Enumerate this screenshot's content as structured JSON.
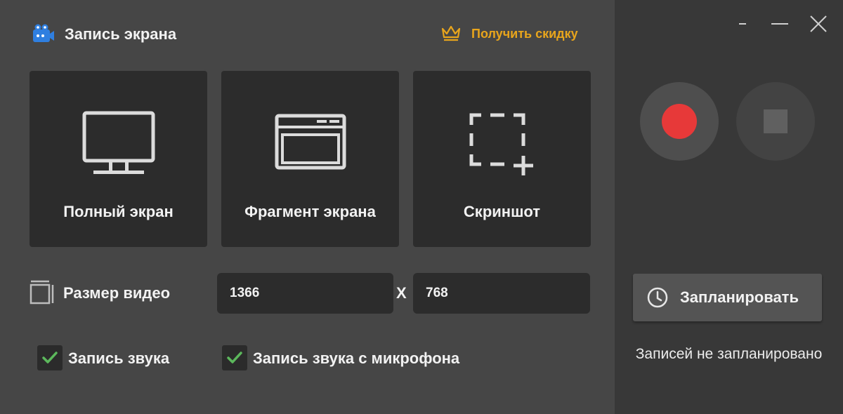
{
  "app": {
    "title": "Запись экрана",
    "discount_link": "Получить скидку"
  },
  "modes": [
    {
      "label": "Полный экран",
      "icon": "monitor-icon"
    },
    {
      "label": "Фрагмент экрана",
      "icon": "window-icon"
    },
    {
      "label": "Скриншот",
      "icon": "selection-plus-icon"
    }
  ],
  "video_size": {
    "label": "Размер видео",
    "width": "1366",
    "separator": "X",
    "height": "768"
  },
  "options": [
    {
      "label": "Запись звука",
      "checked": true
    },
    {
      "label": "Запись звука с микрофона",
      "checked": true
    }
  ],
  "window_controls": [
    "minimize-icon",
    "maximize-icon",
    "close-icon"
  ],
  "recorder": {
    "record_icon": "record-icon",
    "stop_icon": "stop-icon"
  },
  "schedule": {
    "button_label": "Запланировать",
    "status": "Записей не запланировано"
  },
  "colors": {
    "accent": "#e8a51c",
    "record": "#e73939",
    "check": "#5cb85c",
    "panel": "#464646",
    "card": "#2c2c2c"
  }
}
